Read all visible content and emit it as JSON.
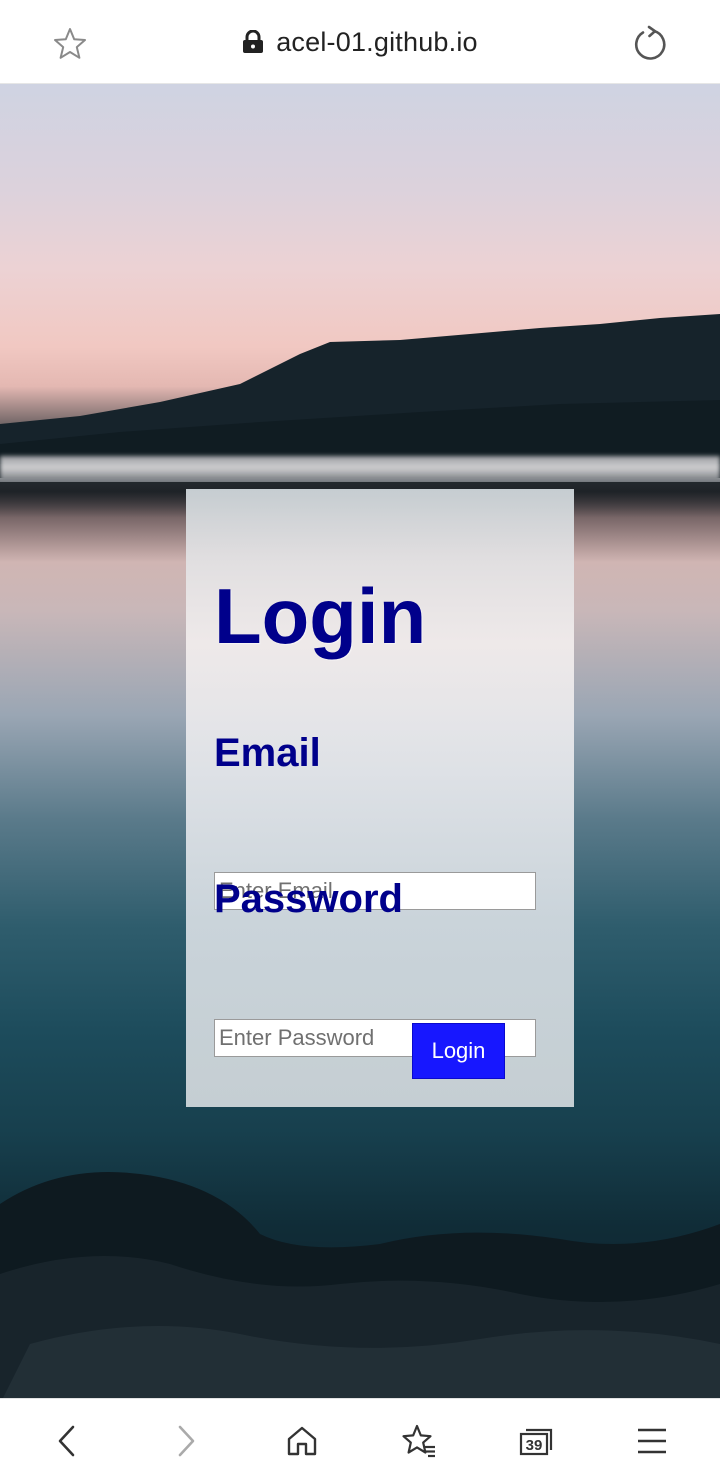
{
  "browser": {
    "url": "acel-01.github.io",
    "tab_count": "39"
  },
  "login_form": {
    "title": "Login",
    "email_label": "Email",
    "email_placeholder": "Enter Email",
    "email_value": "",
    "password_label": "Password",
    "password_placeholder": "Enter Password",
    "password_value": "",
    "submit_label": "Login"
  },
  "colors": {
    "heading": "#00008b",
    "button": "#1717ff"
  },
  "icons": {
    "top_bar": [
      "star-icon",
      "lock-icon",
      "reload-icon"
    ],
    "bottom_bar": [
      "back-icon",
      "forward-icon",
      "home-icon",
      "bookmarks-icon",
      "tabs-icon",
      "menu-icon"
    ]
  }
}
